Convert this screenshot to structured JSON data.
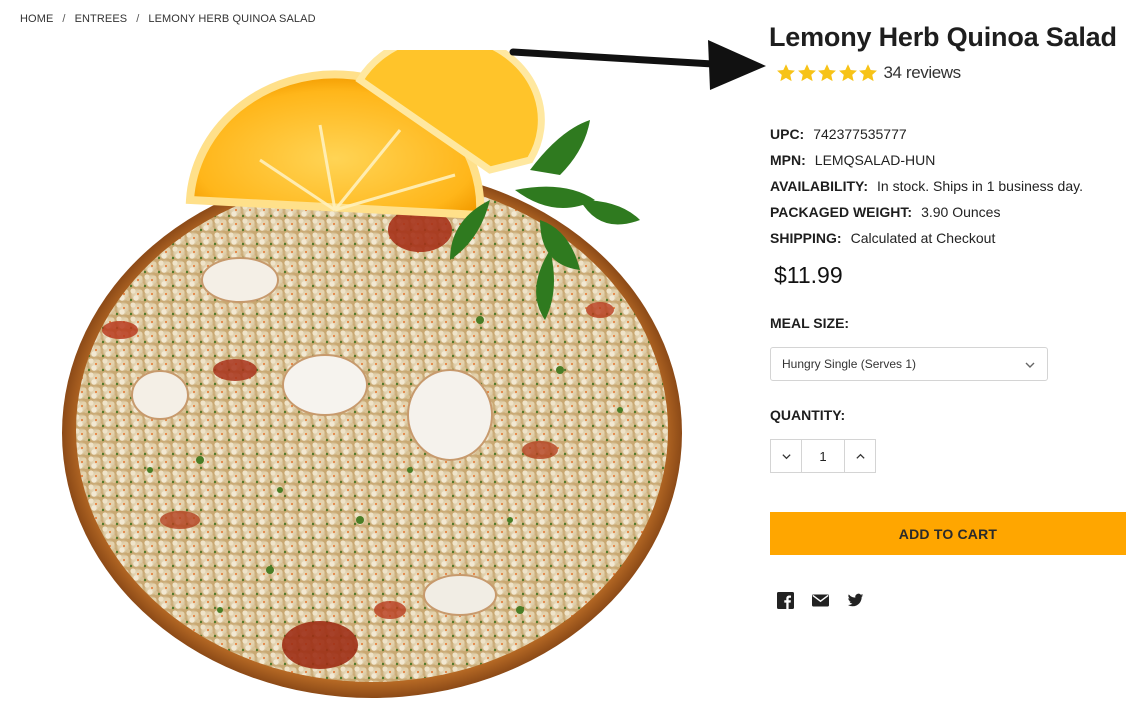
{
  "breadcrumb": {
    "items": [
      "HOME",
      "ENTREES",
      "LEMONY HERB QUINOA SALAD"
    ],
    "separator": "/"
  },
  "product": {
    "title": "Lemony Herb Quinoa Salad",
    "rating": {
      "stars": 5,
      "max": 5,
      "reviews_text": "34 reviews",
      "star_color": "#f7c318"
    },
    "specs": [
      {
        "label": "UPC:",
        "value": "742377535777"
      },
      {
        "label": "MPN:",
        "value": "LEMQSALAD-HUN"
      },
      {
        "label": "AVAILABILITY:",
        "value": "In stock. Ships in 1 business day."
      },
      {
        "label": "PACKAGED WEIGHT:",
        "value": "3.90 Ounces"
      },
      {
        "label": "SHIPPING:",
        "value": "Calculated at Checkout"
      }
    ],
    "price": "$11.99",
    "meal_size": {
      "label": "MEAL SIZE:",
      "selected": "Hungry Single (Serves 1)"
    },
    "quantity": {
      "label": "QUANTITY:",
      "value": "1"
    },
    "add_to_cart": "ADD TO CART",
    "accent_color": "#ffa600"
  },
  "share": {
    "icons": [
      "facebook-icon",
      "email-icon",
      "twitter-icon"
    ]
  }
}
